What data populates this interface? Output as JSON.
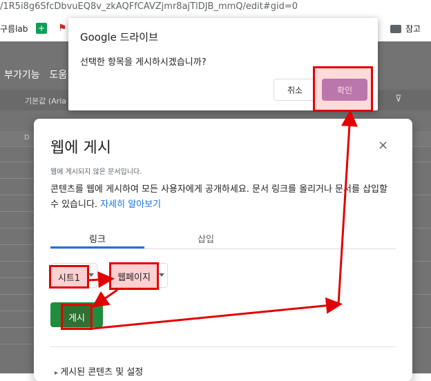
{
  "browser": {
    "url_fragment": "/1R5i8g6SfcDbvuEQ8v_zkAQFfCAVZjmr8ajTlDJB_mmQ/edit#gid=0",
    "bookmarks": [
      {
        "label": "구름lab",
        "icon": ""
      },
      {
        "label": "",
        "icon": "sheets-icon"
      },
      {
        "label": "",
        "icon": "bookmark-icon"
      },
      {
        "label": "참고",
        "icon": "folder-icon"
      }
    ]
  },
  "sheets": {
    "menu": [
      "부가기능",
      "도움"
    ],
    "toolbar_font": "기본값 (Aria",
    "column_letter": "D"
  },
  "confirm_dialog": {
    "title": "Google 드라이브",
    "message": "선택한 항목을 게시하시겠습니까?",
    "cancel_label": "취소",
    "ok_label": "확인"
  },
  "publish_modal": {
    "title": "웹에 게시",
    "close_label": "×",
    "status": "웹에 게시되지 않은 문서입니다.",
    "description": "콘텐츠를 웹에 게시하여 모든 사용자에게 공개하세요. 문서 링크를 올리거나 문서를 삽입할 수 있습니다.",
    "learn_more": "자세히 알아보기",
    "tabs": [
      {
        "label": "링크"
      },
      {
        "label": "삽입"
      }
    ],
    "sheet_select": "시트1",
    "format_select": "웹페이지",
    "publish_label": "게시",
    "published_settings": "게시된 콘텐츠 및 설정"
  },
  "colors": {
    "annotation": "#e20000",
    "ok_button": "#9467b8",
    "publish_button": "#1e8e3e",
    "link_blue": "#1a73e8"
  }
}
